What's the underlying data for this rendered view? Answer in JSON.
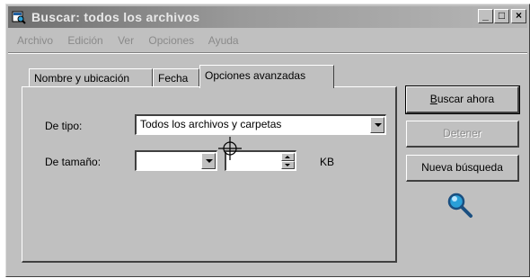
{
  "window": {
    "title": "Buscar: todos los archivos",
    "controls": {
      "minimize": "_",
      "maximize": "□",
      "close": "×"
    }
  },
  "menu": [
    "Archivo",
    "Edición",
    "Ver",
    "Opciones",
    "Ayuda"
  ],
  "tabs": [
    {
      "label": "Nombre y ubicación",
      "active": false
    },
    {
      "label": "Fecha",
      "active": false
    },
    {
      "label": "Opciones avanzadas",
      "active": true
    }
  ],
  "form": {
    "type_label": "De tipo:",
    "type_value": "Todos los archivos y carpetas",
    "size_label": "De tamaño:",
    "size_compare_value": "",
    "size_number_value": "",
    "size_unit": "KB"
  },
  "buttons": {
    "search_now": "Buscar ahora",
    "stop": "Detener",
    "new_search": "Nueva búsqueda"
  },
  "icons": {
    "title": "search-window-icon",
    "magnifier": "magnifier-icon",
    "cursor": "crosshair-cursor-icon"
  },
  "colors": {
    "face": "#c0c0c0",
    "title_gradient_start": "#6f6f6f",
    "disabled_text": "#8a8a8a",
    "magnifier_lens": "#2aa0d8"
  }
}
